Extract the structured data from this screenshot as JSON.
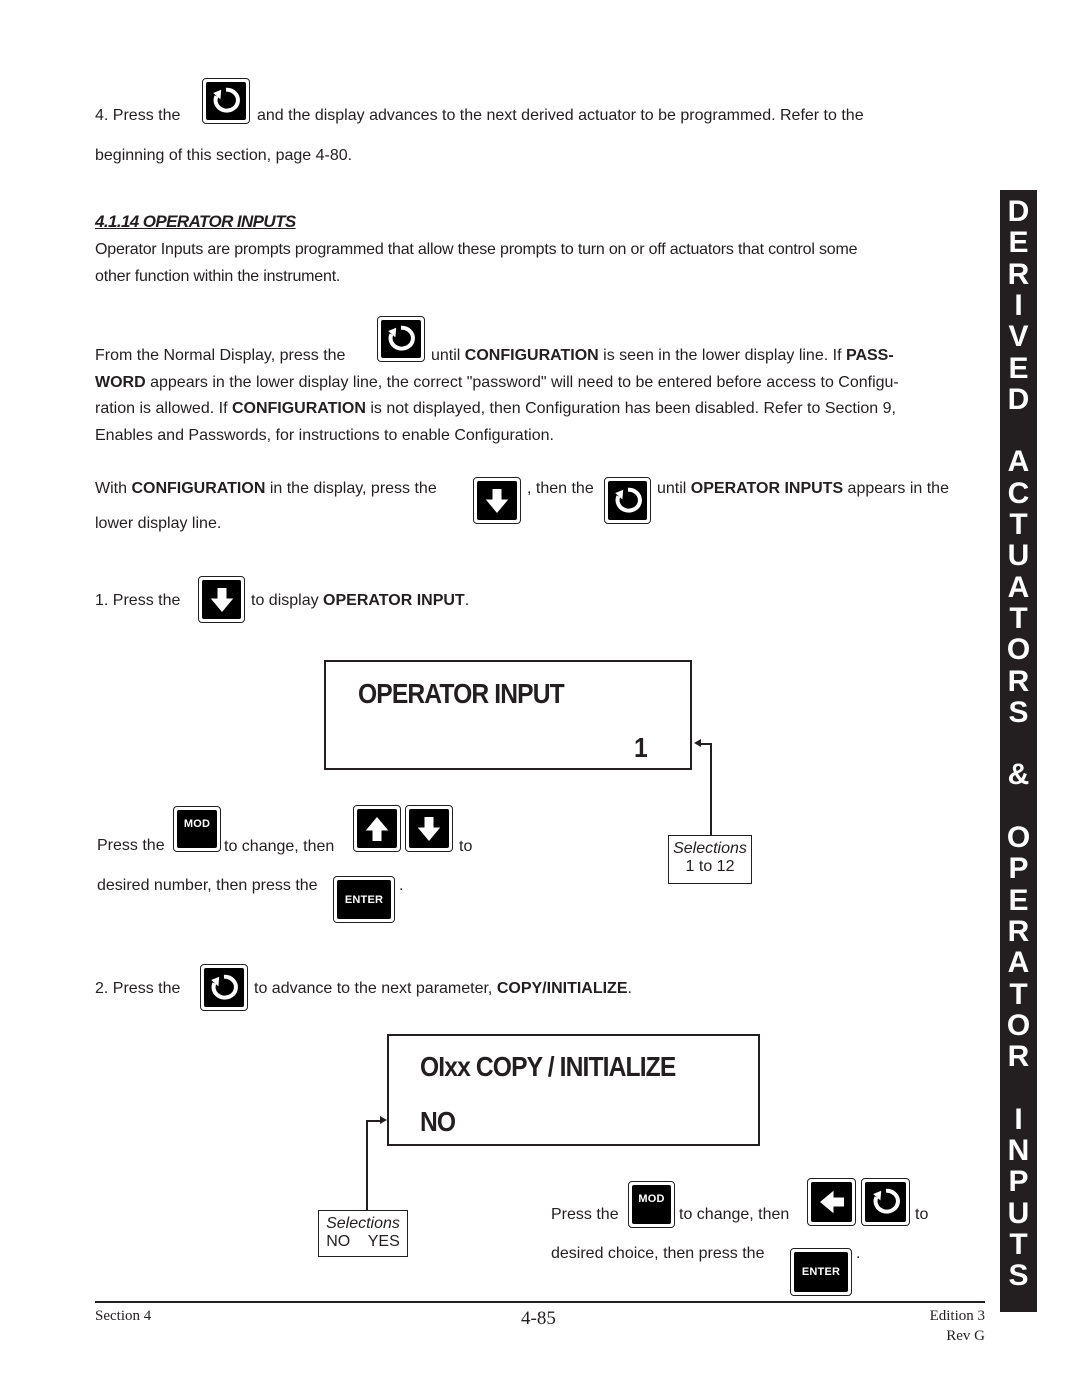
{
  "step4": {
    "prefix": "4.  Press the",
    "suffix": "and the display advances to the next derived actuator to be programmed.  Refer to the",
    "line2": "beginning of this section, page 4-80.",
    "key_icon": "scroll-cycle-key-icon"
  },
  "section": {
    "heading": "4.1.14  OPERATOR INPUTS",
    "intro_line1": "Operator Inputs are prompts programmed that allow these prompts to turn on or off actuators that control some",
    "intro_line2": "other function within the instrument."
  },
  "config_para": {
    "l1_a": "From the Normal Display, press the",
    "l1_b": "until ",
    "l1_bold1": "CONFIGURATION",
    "l1_c": " is seen in the lower display line.  If ",
    "l1_bold2": "PASS-",
    "l2_bold": "WORD",
    "l2_rest": " appears in the lower display line, the correct \"password\" will need to be entered before access to Configu-",
    "l3_a": "ration is allowed.  If ",
    "l3_bold": "CONFIGURATION",
    "l3_rest": " is not displayed, then Configuration has been disabled.  Refer to Section 9,",
    "l4": "Enables and Passwords, for instructions to enable Configuration."
  },
  "with_config": {
    "a": "With ",
    "bold1": "CONFIGURATION",
    "b": " in the display, press the",
    "c": ", then the",
    "d": "until ",
    "bold2": "OPERATOR INPUTS",
    "e": " appears in the",
    "line2": "lower display line."
  },
  "step1": {
    "prefix": "1.  Press the",
    "middle": "to display ",
    "bold": "OPERATOR INPUT",
    "end": "."
  },
  "display1": {
    "line1": "OPERATOR  INPUT",
    "line2": "1"
  },
  "selections1": {
    "title": "Selections",
    "range": "1 to 12"
  },
  "instr1": {
    "press_the": "Press the",
    "mod_label": "MOD",
    "to_change": "to change, then",
    "to": "to",
    "line2": "desired number, then press the",
    "enter_label": "ENTER",
    "period": "."
  },
  "step2": {
    "prefix": "2.  Press the",
    "middle": "to advance to the next parameter, ",
    "bold": "COPY/INITIALIZE",
    "end": "."
  },
  "display2": {
    "line1": "OIxx  COPY / INITIALIZE",
    "line2": "NO"
  },
  "selections2": {
    "title": "Selections",
    "options": "NO    YES"
  },
  "instr2": {
    "press_the": "Press the",
    "mod_label": "MOD",
    "to_change": "to change, then",
    "to": "to",
    "line2": "desired choice, then press the",
    "enter_label": "ENTER",
    "period": "."
  },
  "side_tab": {
    "letters": [
      "D",
      "E",
      "R",
      "I",
      "V",
      "E",
      "D",
      "",
      "A",
      "C",
      "T",
      "U",
      "A",
      "T",
      "O",
      "R",
      "S",
      "",
      "&",
      "",
      "O",
      "P",
      "E",
      "R",
      "A",
      "T",
      "O",
      "R",
      "",
      "I",
      "N",
      "P",
      "U",
      "T",
      "S"
    ]
  },
  "footer": {
    "left": "Section 4",
    "center": "4-85",
    "right1": "Edition 3",
    "right2": "Rev G"
  }
}
